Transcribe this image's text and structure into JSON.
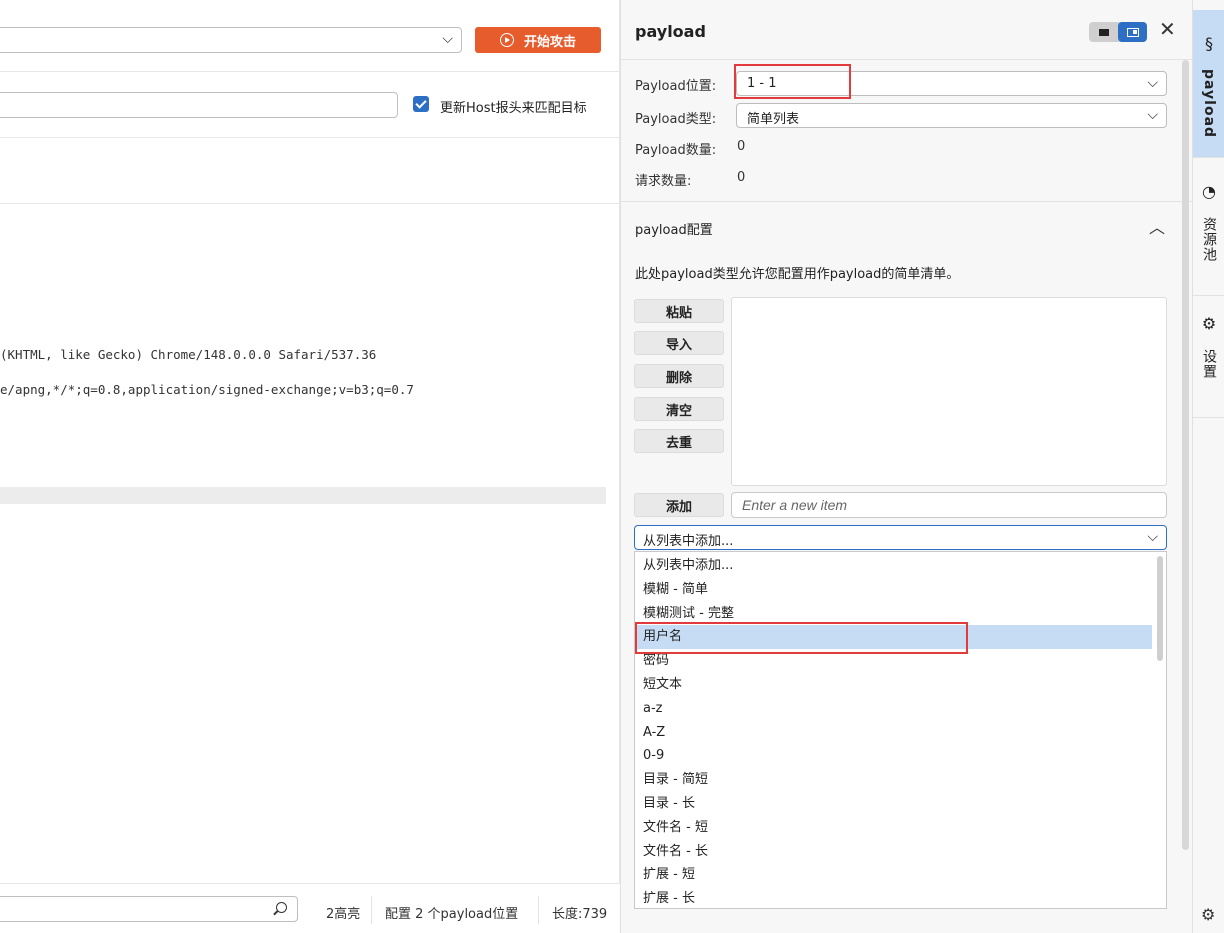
{
  "left": {
    "attack_button": "开始攻击",
    "update_host_label": "更新Host报头来匹配目标",
    "request_line1": "(KHTML, like Gecko) Chrome/148.0.0.0 Safari/537.36",
    "request_line2": "e/apng,*/*;q=0.8,application/signed-exchange;v=b3;q=0.7",
    "status": {
      "highlights": "2高亮",
      "payload_positions": "配置 2 个payload位置",
      "length": "长度:739"
    }
  },
  "panel": {
    "title": "payload",
    "position_label": "Payload位置:",
    "position_value": "1 - 1",
    "type_label": "Payload类型:",
    "type_value": "简单列表",
    "count_label": "Payload数量:",
    "count_value": "0",
    "request_label": "请求数量:",
    "request_value": "0",
    "section_title": "payload配置",
    "section_desc": "此处payload类型允许您配置用作payload的简单清单。",
    "buttons": {
      "paste": "粘贴",
      "import": "导入",
      "delete": "删除",
      "clear": "清空",
      "dedupe": "去重",
      "add": "添加"
    },
    "add_placeholder": "Enter a new item",
    "from_list_value": "从列表中添加...",
    "dropdown_items": [
      "从列表中添加...",
      "模糊 - 简单",
      "模糊测试 - 完整",
      "用户名",
      "密码",
      "短文本",
      "a-z",
      "A-Z",
      "0-9",
      "目录 - 简短",
      "目录 - 长",
      "文件名 - 短",
      "文件名 - 长",
      "扩展 - 短",
      "扩展 - 长"
    ],
    "selected_item": "用户名"
  },
  "sidebar": {
    "payload_label": "payload",
    "resources_label": "资源池",
    "settings_label": "设置"
  },
  "colors": {
    "accent": "#2d6fc4",
    "attack": "#e65c2d",
    "highlight": "#c6dcf4",
    "annotation": "#e33b3b"
  }
}
